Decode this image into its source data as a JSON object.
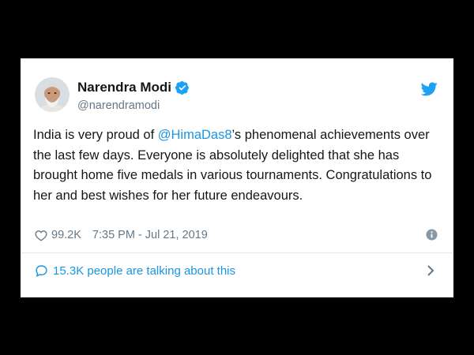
{
  "tweet": {
    "display_name": "Narendra Modi",
    "handle": "@narendramodi",
    "text_before": "India is very proud of ",
    "mention": "@HimaDas8",
    "text_after": "’s phenomenal achievements over the last few days. Everyone is absolutely delighted that she has brought home five medals in various tournaments. Congratulations to her and best wishes for her future endeavours.",
    "likes": "99.2K",
    "timestamp": "7:35 PM - Jul 21, 2019",
    "talking": "15.3K people are talking about this"
  },
  "icons": {
    "verified": "verified-badge-icon",
    "brand": "twitter-bird-icon",
    "like": "heart-icon",
    "info": "info-icon",
    "reply": "speech-bubble-icon",
    "chevron": "chevron-right-icon"
  },
  "colors": {
    "background": "#000000",
    "card": "#ffffff",
    "accent": "#1da1f2",
    "link": "#1b95e0",
    "muted": "#657786",
    "text": "#14171a"
  }
}
